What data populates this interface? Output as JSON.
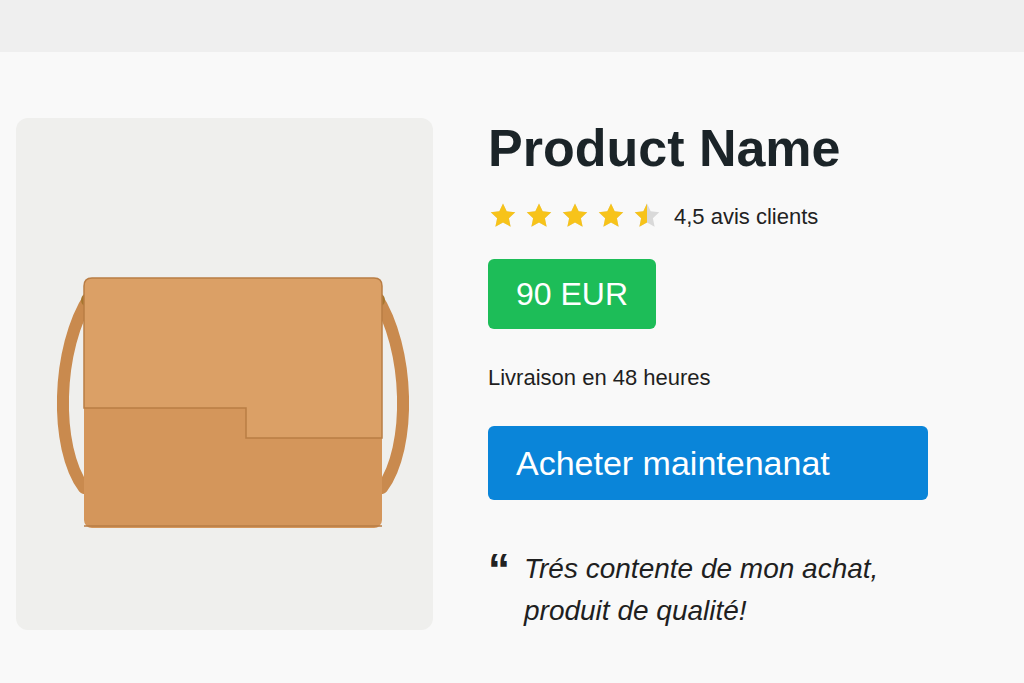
{
  "product": {
    "name": "Product Name"
  },
  "rating": {
    "stars": 4.5,
    "max": 5,
    "label": "4,5 avis clients"
  },
  "price": "90 EUR",
  "delivery": "Livraison en 48 heures",
  "buy_button": {
    "label": "Acheter maintenanat"
  },
  "review": {
    "quote_mark": "“",
    "lines": [
      "Trés contente de mon achat,",
      "produit de qualité!"
    ]
  }
}
